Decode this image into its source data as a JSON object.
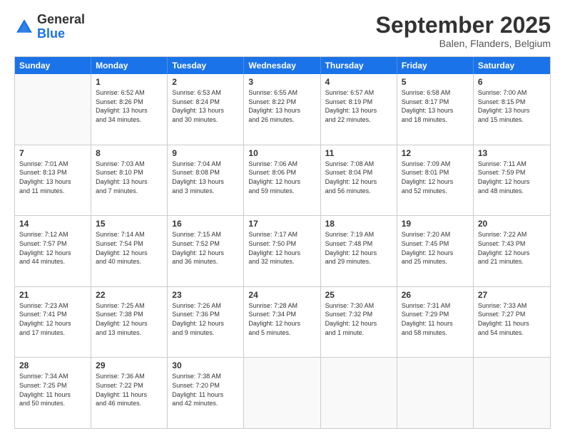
{
  "header": {
    "logo": {
      "general": "General",
      "blue": "Blue"
    },
    "title": "September 2025",
    "location": "Balen, Flanders, Belgium"
  },
  "days_of_week": [
    "Sunday",
    "Monday",
    "Tuesday",
    "Wednesday",
    "Thursday",
    "Friday",
    "Saturday"
  ],
  "weeks": [
    [
      {
        "day": "",
        "info": ""
      },
      {
        "day": "1",
        "info": "Sunrise: 6:52 AM\nSunset: 8:26 PM\nDaylight: 13 hours\nand 34 minutes."
      },
      {
        "day": "2",
        "info": "Sunrise: 6:53 AM\nSunset: 8:24 PM\nDaylight: 13 hours\nand 30 minutes."
      },
      {
        "day": "3",
        "info": "Sunrise: 6:55 AM\nSunset: 8:22 PM\nDaylight: 13 hours\nand 26 minutes."
      },
      {
        "day": "4",
        "info": "Sunrise: 6:57 AM\nSunset: 8:19 PM\nDaylight: 13 hours\nand 22 minutes."
      },
      {
        "day": "5",
        "info": "Sunrise: 6:58 AM\nSunset: 8:17 PM\nDaylight: 13 hours\nand 18 minutes."
      },
      {
        "day": "6",
        "info": "Sunrise: 7:00 AM\nSunset: 8:15 PM\nDaylight: 13 hours\nand 15 minutes."
      }
    ],
    [
      {
        "day": "7",
        "info": "Sunrise: 7:01 AM\nSunset: 8:13 PM\nDaylight: 13 hours\nand 11 minutes."
      },
      {
        "day": "8",
        "info": "Sunrise: 7:03 AM\nSunset: 8:10 PM\nDaylight: 13 hours\nand 7 minutes."
      },
      {
        "day": "9",
        "info": "Sunrise: 7:04 AM\nSunset: 8:08 PM\nDaylight: 13 hours\nand 3 minutes."
      },
      {
        "day": "10",
        "info": "Sunrise: 7:06 AM\nSunset: 8:06 PM\nDaylight: 12 hours\nand 59 minutes."
      },
      {
        "day": "11",
        "info": "Sunrise: 7:08 AM\nSunset: 8:04 PM\nDaylight: 12 hours\nand 56 minutes."
      },
      {
        "day": "12",
        "info": "Sunrise: 7:09 AM\nSunset: 8:01 PM\nDaylight: 12 hours\nand 52 minutes."
      },
      {
        "day": "13",
        "info": "Sunrise: 7:11 AM\nSunset: 7:59 PM\nDaylight: 12 hours\nand 48 minutes."
      }
    ],
    [
      {
        "day": "14",
        "info": "Sunrise: 7:12 AM\nSunset: 7:57 PM\nDaylight: 12 hours\nand 44 minutes."
      },
      {
        "day": "15",
        "info": "Sunrise: 7:14 AM\nSunset: 7:54 PM\nDaylight: 12 hours\nand 40 minutes."
      },
      {
        "day": "16",
        "info": "Sunrise: 7:15 AM\nSunset: 7:52 PM\nDaylight: 12 hours\nand 36 minutes."
      },
      {
        "day": "17",
        "info": "Sunrise: 7:17 AM\nSunset: 7:50 PM\nDaylight: 12 hours\nand 32 minutes."
      },
      {
        "day": "18",
        "info": "Sunrise: 7:19 AM\nSunset: 7:48 PM\nDaylight: 12 hours\nand 29 minutes."
      },
      {
        "day": "19",
        "info": "Sunrise: 7:20 AM\nSunset: 7:45 PM\nDaylight: 12 hours\nand 25 minutes."
      },
      {
        "day": "20",
        "info": "Sunrise: 7:22 AM\nSunset: 7:43 PM\nDaylight: 12 hours\nand 21 minutes."
      }
    ],
    [
      {
        "day": "21",
        "info": "Sunrise: 7:23 AM\nSunset: 7:41 PM\nDaylight: 12 hours\nand 17 minutes."
      },
      {
        "day": "22",
        "info": "Sunrise: 7:25 AM\nSunset: 7:38 PM\nDaylight: 12 hours\nand 13 minutes."
      },
      {
        "day": "23",
        "info": "Sunrise: 7:26 AM\nSunset: 7:36 PM\nDaylight: 12 hours\nand 9 minutes."
      },
      {
        "day": "24",
        "info": "Sunrise: 7:28 AM\nSunset: 7:34 PM\nDaylight: 12 hours\nand 5 minutes."
      },
      {
        "day": "25",
        "info": "Sunrise: 7:30 AM\nSunset: 7:32 PM\nDaylight: 12 hours\nand 1 minute."
      },
      {
        "day": "26",
        "info": "Sunrise: 7:31 AM\nSunset: 7:29 PM\nDaylight: 11 hours\nand 58 minutes."
      },
      {
        "day": "27",
        "info": "Sunrise: 7:33 AM\nSunset: 7:27 PM\nDaylight: 11 hours\nand 54 minutes."
      }
    ],
    [
      {
        "day": "28",
        "info": "Sunrise: 7:34 AM\nSunset: 7:25 PM\nDaylight: 11 hours\nand 50 minutes."
      },
      {
        "day": "29",
        "info": "Sunrise: 7:36 AM\nSunset: 7:22 PM\nDaylight: 11 hours\nand 46 minutes."
      },
      {
        "day": "30",
        "info": "Sunrise: 7:38 AM\nSunset: 7:20 PM\nDaylight: 11 hours\nand 42 minutes."
      },
      {
        "day": "",
        "info": ""
      },
      {
        "day": "",
        "info": ""
      },
      {
        "day": "",
        "info": ""
      },
      {
        "day": "",
        "info": ""
      }
    ]
  ]
}
